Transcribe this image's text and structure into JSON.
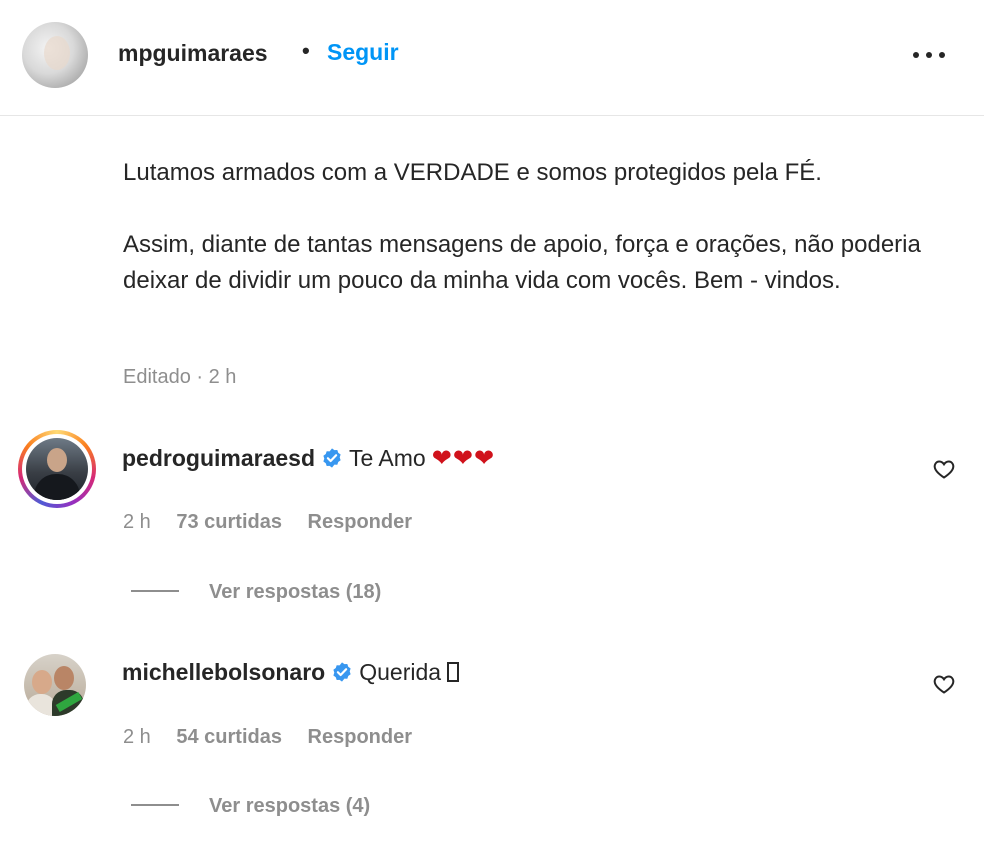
{
  "post": {
    "username": "mpguimaraes",
    "separator": "•",
    "follow_label": "Seguir",
    "more_icon": "more-horizontal-icon",
    "caption_paragraphs": [
      "Lutamos armados com a VERDADE e somos protegidos pela FÉ.",
      "Assim, diante de tantas mensagens de apoio, força e orações, não poderia deixar de dividir um pouco da minha vida com vocês. Bem - vindos."
    ],
    "meta": "Editado · 2 h"
  },
  "comments": [
    {
      "username": "pedroguimaraesd",
      "verified": true,
      "text": "Te Amo",
      "emoji": "❤❤❤",
      "time": "2 h",
      "likes": "73 curtidas",
      "reply_label": "Responder",
      "view_replies": "Ver respostas (18)",
      "has_story_ring": true
    },
    {
      "username": "michellebolsonaro",
      "verified": true,
      "text": "Querida",
      "emoji": "",
      "time": "2 h",
      "likes": "54 curtidas",
      "reply_label": "Responder",
      "view_replies": "Ver respostas (4)",
      "has_story_ring": false
    }
  ],
  "colors": {
    "link_blue": "#0095f6",
    "verified_blue": "#3897f0",
    "muted_gray": "#8e8e8e",
    "text": "#262626",
    "heart_red": "#d0121b"
  }
}
